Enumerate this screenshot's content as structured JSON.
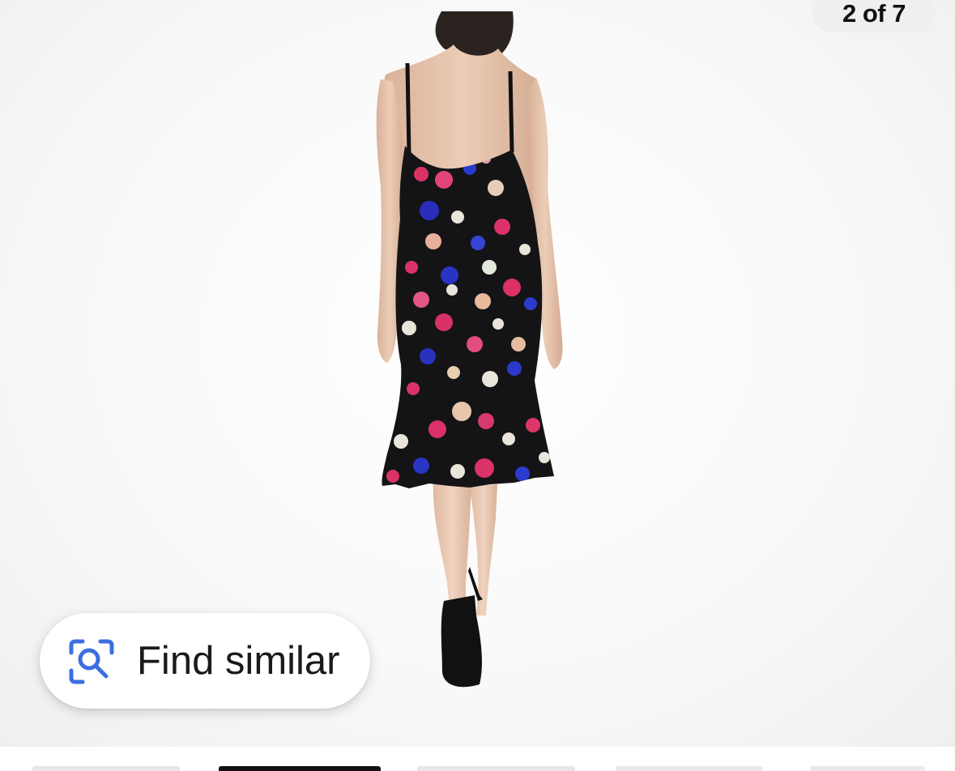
{
  "gallery": {
    "counter_text": "2 of 7",
    "current_index": 2,
    "total_images": 7
  },
  "find_similar": {
    "label": "Find similar",
    "icon": "visual-search-icon",
    "icon_color": "#3b6fe0"
  },
  "thumbnails": [
    {
      "name": "thumbnail-1",
      "selected": false
    },
    {
      "name": "thumbnail-2",
      "selected": true
    },
    {
      "name": "thumbnail-3",
      "selected": false
    },
    {
      "name": "thumbnail-4",
      "selected": false
    },
    {
      "name": "thumbnail-5",
      "selected": false
    }
  ],
  "colors": {
    "background": "#ffffff",
    "counter_pill": "#efefef",
    "dress_base": "#141416"
  }
}
